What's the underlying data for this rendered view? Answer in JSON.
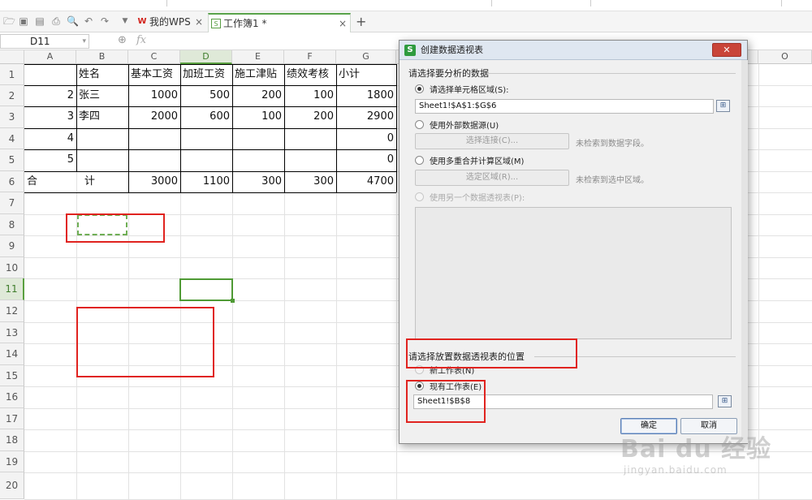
{
  "tabs": {
    "wps_home": {
      "label": "我的WPS",
      "close": "×"
    },
    "workbook": {
      "label": "工作簿1 *",
      "close": "×"
    },
    "new_tab": "+"
  },
  "formula_bar": {
    "name_box": "D11",
    "fx": "fx"
  },
  "columns": [
    "A",
    "B",
    "C",
    "D",
    "E",
    "F",
    "G",
    "O"
  ],
  "selected_column": "D",
  "rows": [
    "1",
    "2",
    "3",
    "4",
    "5",
    "6",
    "7",
    "8",
    "9",
    "10",
    "11",
    "12",
    "13",
    "14",
    "15",
    "16",
    "17",
    "18",
    "19",
    "20"
  ],
  "selected_row": "11",
  "sheet": {
    "headers": {
      "b": "姓名",
      "c": "基本工资",
      "d": "加班工资",
      "e": "施工津贴",
      "f": "绩效考核",
      "g": "小计"
    },
    "rows": [
      {
        "a": "2",
        "b": "张三",
        "c": "1000",
        "d": "500",
        "e": "200",
        "f": "100",
        "g": "1800"
      },
      {
        "a": "3",
        "b": "李四",
        "c": "2000",
        "d": "600",
        "e": "100",
        "f": "200",
        "g": "2900"
      },
      {
        "a": "4",
        "b": "",
        "c": "",
        "d": "",
        "e": "",
        "f": "",
        "g": "0"
      },
      {
        "a": "5",
        "b": "",
        "c": "",
        "d": "",
        "e": "",
        "f": "",
        "g": "0"
      },
      {
        "a": "合",
        "b": "计",
        "c": "3000",
        "d": "1100",
        "e": "300",
        "f": "300",
        "g": "4700"
      }
    ]
  },
  "dialog": {
    "title": "创建数据透视表",
    "close": "关闭",
    "section1": "请选择要分析的数据",
    "opt_range": "请选择单元格区域(S):",
    "range_value": "Sheet1!$A$1:$G$6",
    "opt_external": "使用外部数据源(U)",
    "btn_connect": "选择连接(C)...",
    "hint_connect": "未检索到数据字段。",
    "opt_multi": "使用多重合并计算区域(M)",
    "btn_select_range": "选定区域(R)...",
    "hint_range": "未检索到选中区域。",
    "opt_other_pivot": "使用另一个数据透视表(P):",
    "section2": "请选择放置数据透视表的位置",
    "opt_new_sheet": "新工作表(N)",
    "opt_existing_sheet": "现有工作表(E)",
    "location_value": "Sheet1!$B$8",
    "ok": "确定",
    "cancel": "取消"
  },
  "watermark": {
    "brand": "Bai du 经验",
    "url": "jingyan.baidu.com"
  },
  "colors": {
    "selection": "#5aa040",
    "annotation": "#e0231f",
    "wps_red": "#d2231c"
  }
}
